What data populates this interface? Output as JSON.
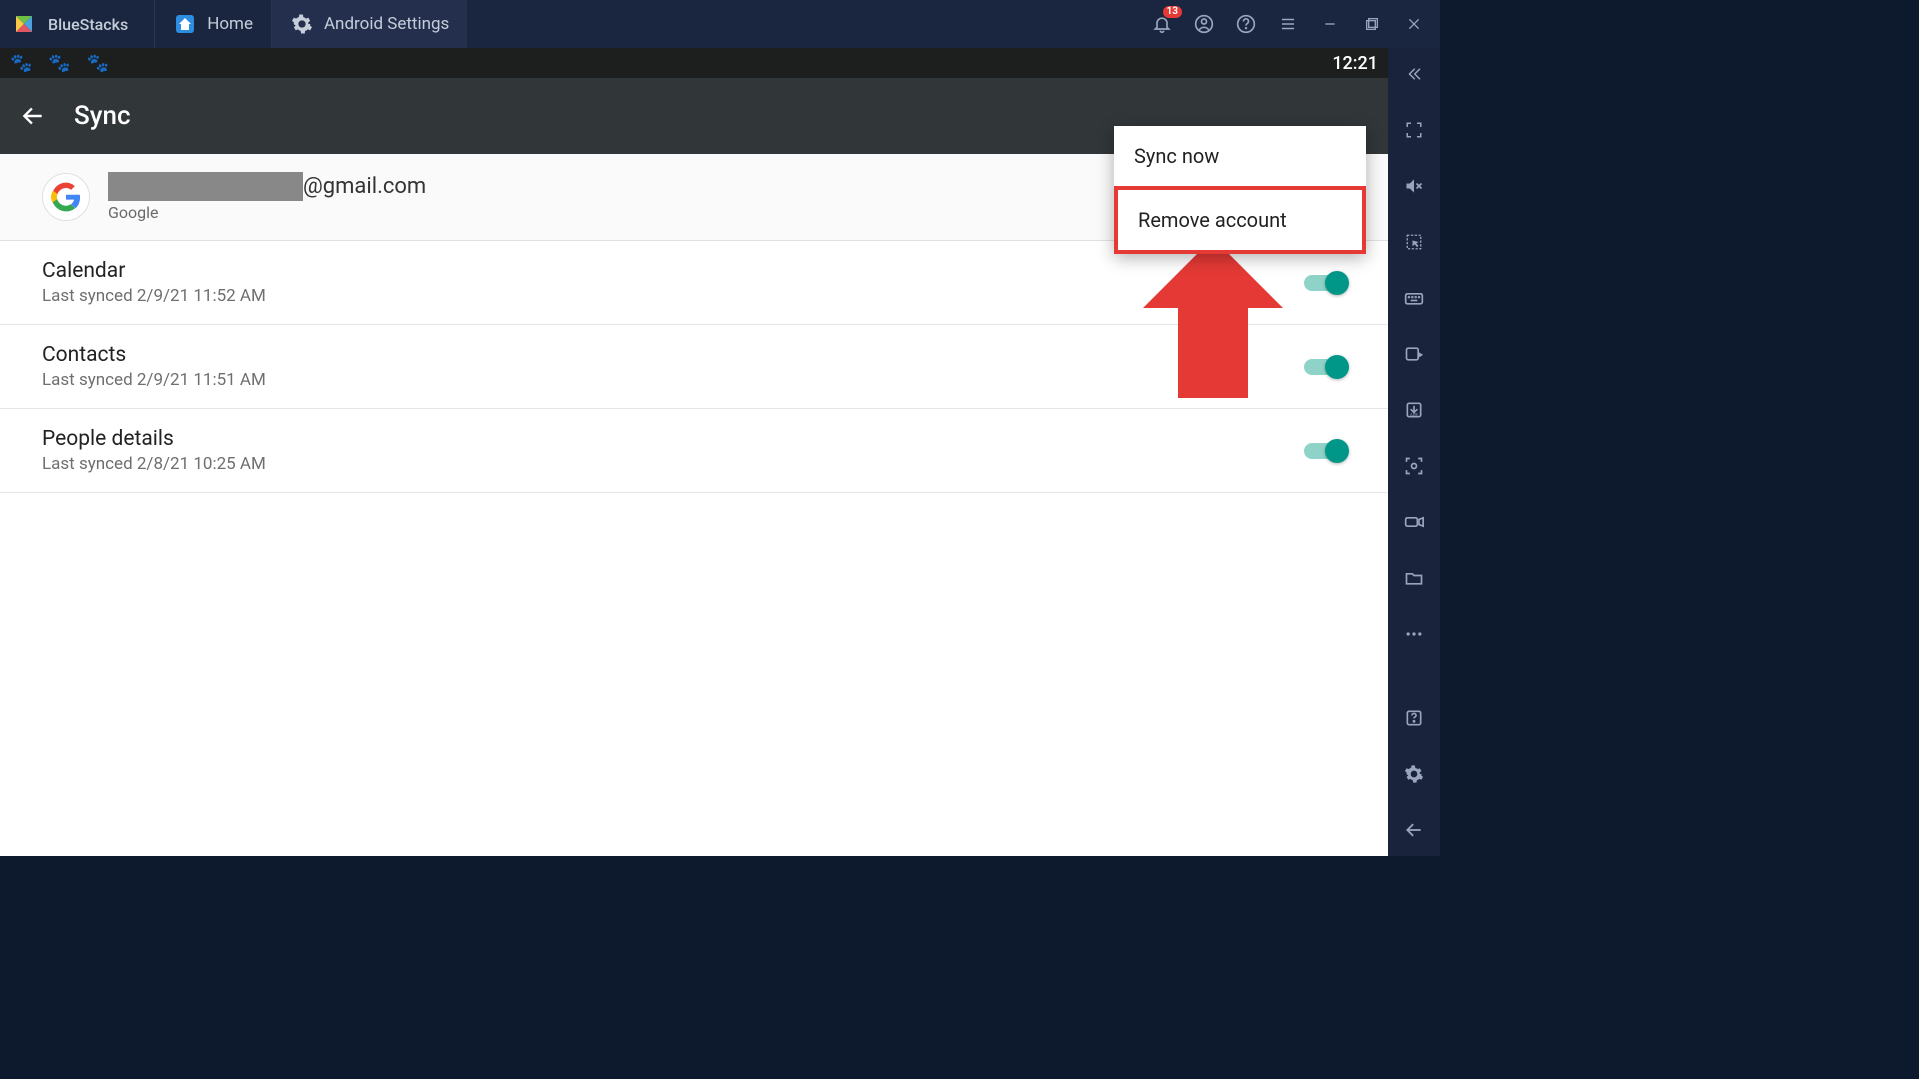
{
  "titlebar": {
    "brand": "BlueStacks",
    "tabs": [
      {
        "label": "Home",
        "icon": "home-icon"
      },
      {
        "label": "Android Settings",
        "icon": "gear-icon"
      }
    ],
    "notification_count": "13"
  },
  "status_bar": {
    "time": "12:21"
  },
  "app_bar": {
    "title": "Sync"
  },
  "account": {
    "email_domain": "@gmail.com",
    "provider": "Google"
  },
  "sync_items": [
    {
      "title": "Calendar",
      "sub": "Last synced 2/9/21 11:52 AM"
    },
    {
      "title": "Contacts",
      "sub": "Last synced 2/9/21 11:51 AM"
    },
    {
      "title": "People details",
      "sub": "Last synced 2/8/21 10:25 AM"
    }
  ],
  "popup": {
    "sync_now": "Sync now",
    "remove_account": "Remove account"
  }
}
